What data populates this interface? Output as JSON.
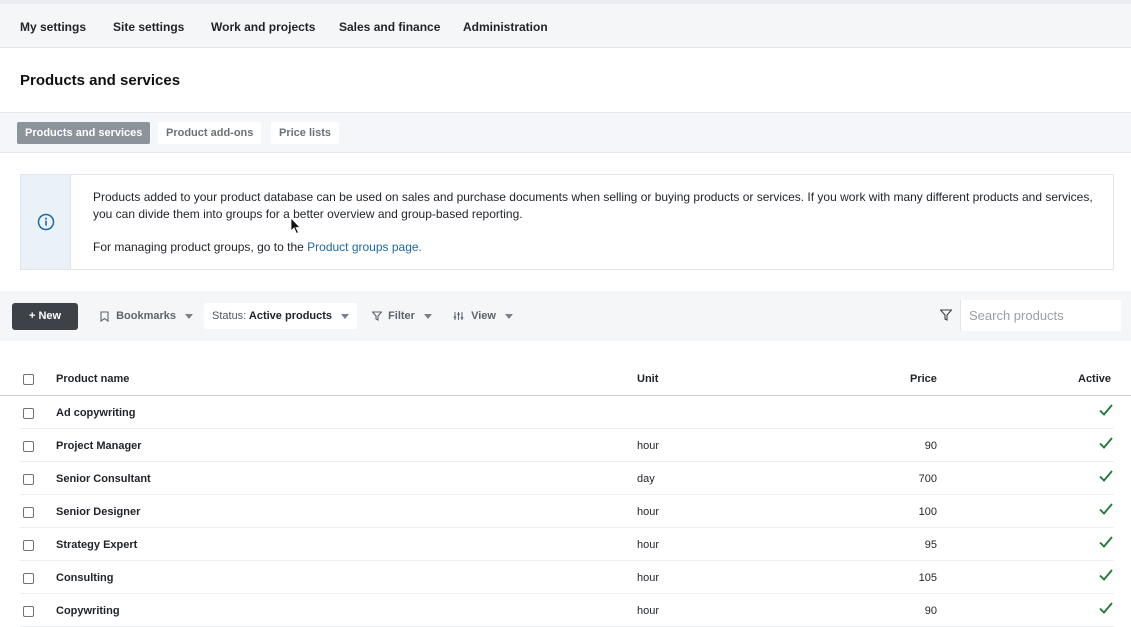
{
  "nav": {
    "items": [
      "My settings",
      "Site settings",
      "Work and projects",
      "Sales and finance",
      "Administration"
    ]
  },
  "page": {
    "title": "Products and services"
  },
  "subtabs": {
    "items": [
      "Products and services",
      "Product add-ons",
      "Price lists"
    ],
    "active": "Products and services"
  },
  "info": {
    "text": "Products added to your product database can be used on sales and purchase documents when selling or buying products or services. If you work with many different products and services, you can divide them into groups for a better overview and group-based reporting.",
    "text2_prefix": "For managing product groups, go to the ",
    "link": "Product groups page."
  },
  "toolbar": {
    "new_label": "New",
    "bookmarks_label": "Bookmarks",
    "status_label": "Status:",
    "status_value": "Active products",
    "filter_label": "Filter",
    "view_label": "View",
    "search_placeholder": "Search products"
  },
  "table": {
    "headers": {
      "name": "Product name",
      "unit": "Unit",
      "price": "Price",
      "active": "Active"
    },
    "rows": [
      {
        "name": "Ad copywriting",
        "unit": "",
        "price": "",
        "active": true
      },
      {
        "name": "Project Manager",
        "unit": "hour",
        "price": "90",
        "active": true
      },
      {
        "name": "Senior Consultant",
        "unit": "day",
        "price": "700",
        "active": true
      },
      {
        "name": "Senior Designer",
        "unit": "hour",
        "price": "100",
        "active": true
      },
      {
        "name": "Strategy Expert",
        "unit": "hour",
        "price": "95",
        "active": true
      },
      {
        "name": "Consulting",
        "unit": "hour",
        "price": "105",
        "active": true
      },
      {
        "name": "Copywriting",
        "unit": "hour",
        "price": "90",
        "active": true
      }
    ]
  },
  "colors": {
    "accent_link": "#1b6aa8",
    "check_green": "#1d7a35",
    "primary_button": "#3c4247"
  }
}
